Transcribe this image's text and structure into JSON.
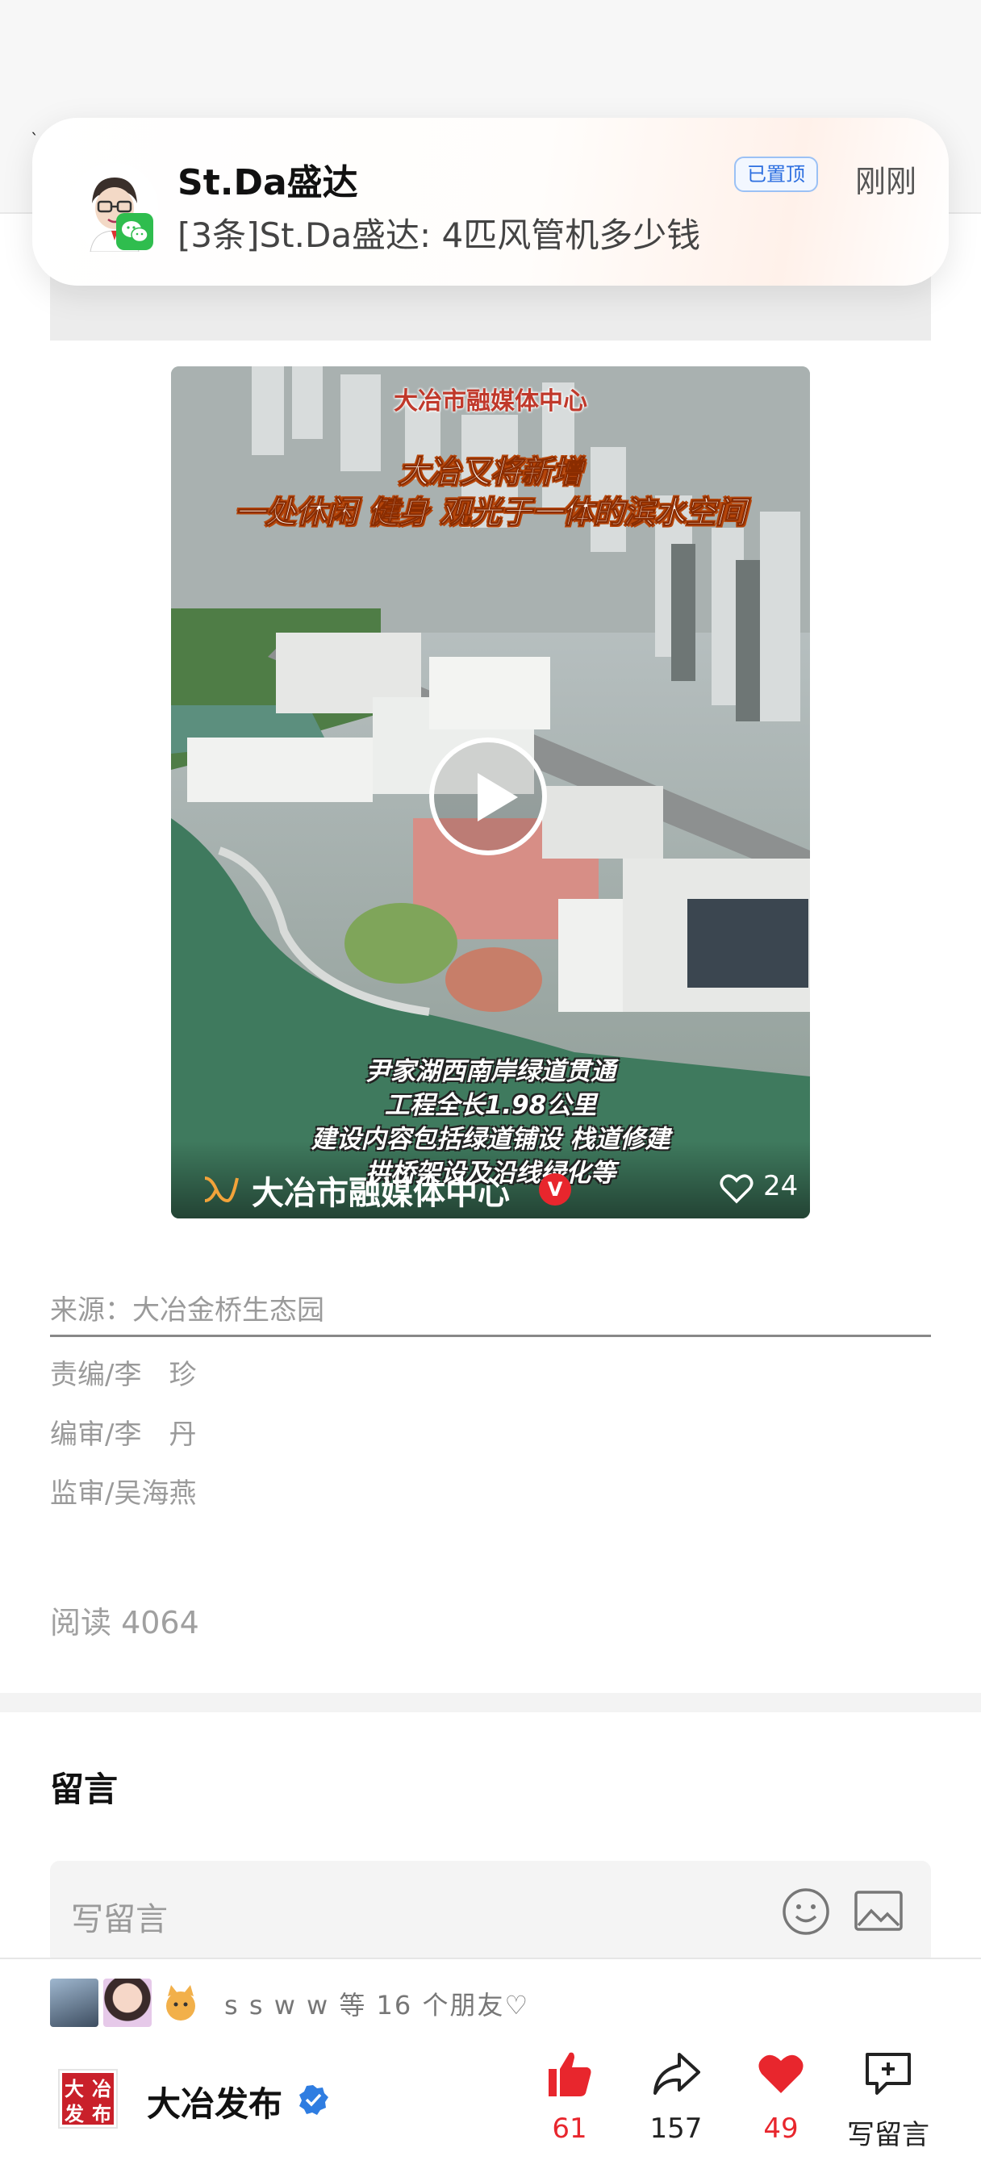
{
  "notification": {
    "sender": "St.Da盛达",
    "message": "[3条]St.Da盛达: 4匹风管机多少钱",
    "pinned_label": "已置顶",
    "time": "刚刚",
    "app_icon": "wechat-icon"
  },
  "video": {
    "top_title": "大冶市融媒体中心",
    "headline_line1": "大冶又将新增",
    "headline_line2": "一处休闲 健身 观光于一体的滨水空间",
    "caption_line1": "尹家湖西南岸绿道贯通",
    "caption_line2": "工程全长1.98公里",
    "caption_line3": "建设内容包括绿道铺设 栈道修建",
    "caption_line4": "拱桥架设及沿线绿化等",
    "channel_name": "大冶市融媒体中心",
    "verified_mark": "V",
    "likes": "24"
  },
  "article_meta": {
    "source": "来源：大冶金桥生态园",
    "editor": "责编/李　珍",
    "reviewer": "编审/李　丹",
    "supervisor": "监审/吴海燕",
    "reads": "阅读 4064"
  },
  "comments": {
    "title": "留言",
    "placeholder": "写留言"
  },
  "bottom_bar": {
    "friends_text": "s s w w 等 16 个朋友♡",
    "publisher_name": "大冶发布",
    "logo_chars": [
      "大",
      "冶",
      "发",
      "布"
    ],
    "likes": "61",
    "shares": "157",
    "favorites": "49",
    "write_comment": "写留言",
    "colors": {
      "like": "#e8262d",
      "fav": "#e8262d",
      "verified": "#2f7de1"
    }
  }
}
